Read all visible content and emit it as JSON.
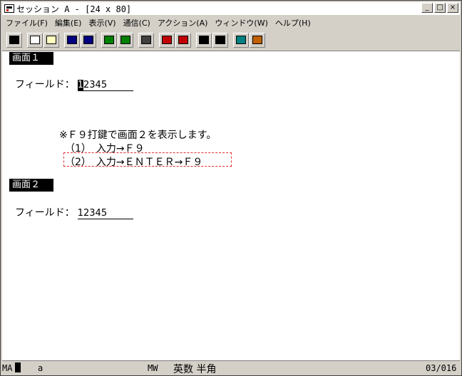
{
  "window": {
    "title": "セッション A - [24 x 80]",
    "buttons": {
      "minimize": "_",
      "maximize": "□",
      "close": "×"
    }
  },
  "menu": [
    "ファイル(F)",
    "編集(E)",
    "表示(V)",
    "通信(C)",
    "アクション(A)",
    "ウィンドウ(W)",
    "ヘルプ(H)"
  ],
  "toolbar": {
    "groups": [
      [
        {
          "icon": "print-screen-icon",
          "color": "#000000"
        }
      ],
      [
        {
          "icon": "copy-icon",
          "color": "#ffffff"
        },
        {
          "icon": "paste-icon",
          "color": "#ffffc0"
        }
      ],
      [
        {
          "icon": "send-file-icon",
          "color": "#000080"
        },
        {
          "icon": "receive-file-icon",
          "color": "#000080"
        }
      ],
      [
        {
          "icon": "display-setup-icon",
          "color": "#008000"
        },
        {
          "icon": "keyboard-setup-icon",
          "color": "#008000"
        }
      ],
      [
        {
          "icon": "keypad-icon",
          "color": "#404040"
        }
      ],
      [
        {
          "icon": "record-macro-icon",
          "color": "#c00000"
        },
        {
          "icon": "stop-macro-icon",
          "color": "#c00000"
        }
      ],
      [
        {
          "icon": "play-macro-icon",
          "color": "#000000"
        },
        {
          "icon": "stop-playback-icon",
          "color": "#000000"
        }
      ],
      [
        {
          "icon": "connect-icon",
          "color": "#008080"
        },
        {
          "icon": "disconnect-icon",
          "color": "#c06000"
        }
      ]
    ]
  },
  "screen": {
    "screen1": {
      "label": "画面１",
      "field_label": "フィールド：",
      "field_value_cursor": "1",
      "field_value_rest": "2345"
    },
    "instructions": {
      "heading": "※Ｆ９打鍵で画面２を表示します。",
      "step1": "（1）　入力→Ｆ９",
      "step2": "（2）　入力→ＥＮＴＥＲ→Ｆ９",
      "highlight_color": "#e23030"
    },
    "screen2": {
      "label": "画面２",
      "field_label": "フィールド：",
      "field_value": "12345"
    }
  },
  "status": {
    "mode": "MA",
    "session": "a",
    "indicator": "MW",
    "input_mode": "英数 半角",
    "position": "03/016"
  }
}
